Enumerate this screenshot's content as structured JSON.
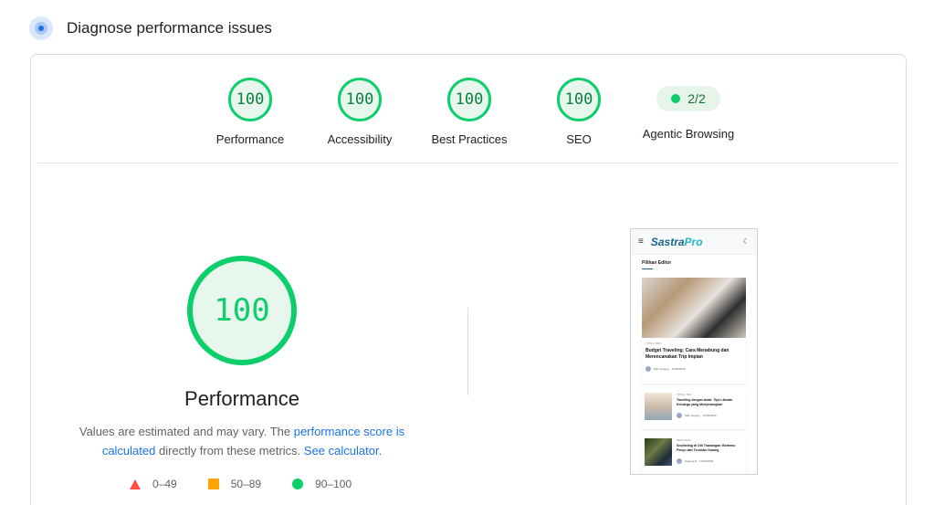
{
  "header": {
    "title": "Diagnose performance issues"
  },
  "scores": [
    {
      "label": "Performance",
      "value": "100"
    },
    {
      "label": "Accessibility",
      "value": "100"
    },
    {
      "label": "Best Practices",
      "value": "100"
    },
    {
      "label": "SEO",
      "value": "100"
    }
  ],
  "agentic": {
    "label": "Agentic Browsing",
    "value": "2/2"
  },
  "main": {
    "score": "100",
    "label": "Performance",
    "note_prefix": "Values are estimated and may vary. The ",
    "note_link": "performance score is calculated",
    "note_middle": " directly from these metrics. ",
    "note_calc_link": "See calculator."
  },
  "legend": [
    {
      "shape": "triangle",
      "range": "0–49",
      "color": "#ff4e42"
    },
    {
      "shape": "square",
      "range": "50–89",
      "color": "#ffa400"
    },
    {
      "shape": "circle",
      "range": "90–100",
      "color": "#0cce6b"
    }
  ],
  "colors": {
    "pass": "#0cce6b",
    "link": "#1a73e8"
  },
  "screenshot": {
    "logo_a": "Sastra",
    "logo_b": "Pro",
    "section": "Pilihan Editor",
    "hero_tag": "TIPS & TRIK",
    "hero_title": "Budget Traveling: Cara Menabung dan Merencanakan Trip Impian",
    "hero_author": "Mas Sugeng",
    "hero_date": "12/06/2025",
    "items": [
      {
        "tag": "TIPS & TRIK",
        "title": "Traveling dengan Anak: Tips Liburan Keluarga yang Menyenangkan",
        "author": "Mas Sugeng",
        "date": "12/06/2025"
      },
      {
        "tag": "DESTINASI",
        "title": "Snorkeling di Gili Trawangan: Bertemu Penyu dan Terumbu Karang",
        "author": "Sugeng R",
        "date": "12/06/2025"
      }
    ]
  }
}
